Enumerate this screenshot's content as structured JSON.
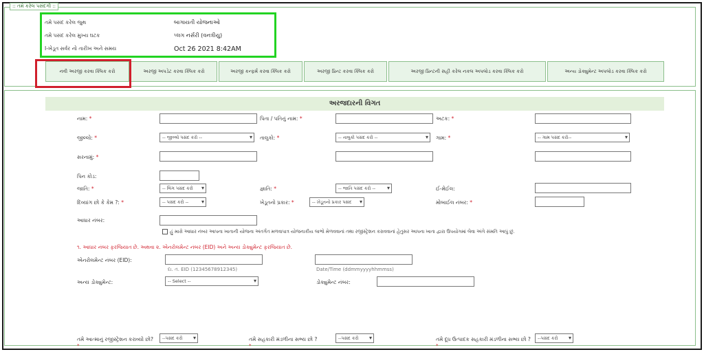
{
  "legend": ":: તમે કરેલ પસંદગી ::",
  "info": [
    {
      "label": "તમે પસંદ કરેલ જુથ",
      "value": "બાગાયતી યોજનાઓ"
    },
    {
      "label": "તમે પસંદ કરેલ મુખ્ય ઘટક",
      "value": "પ્લગ નર્સરી (વનત્રીયુ)"
    },
    {
      "label": "I-ખેડૂત સર્વર નો તારીખ અને સમય",
      "value": "Oct 26 2021 8:42AM"
    }
  ],
  "tabs": [
    "નવી અરજી કરવા ક્લિક કરો",
    "અરજી અપડેટ કરવા ક્લિક કરો",
    "અરજી કન્ફર્મ કરવા ક્લિક કરો",
    "અરજી પ્રિન્ટ કરવા ક્લિક કરો",
    "અરજી પ્રિન્ટની સહી કરેલ નકલ અપલોડ કરવા ક્લિક કરો",
    "અન્ય ડોક્યુમેન્ટ અપલોડ કરવા ક્લિક કરો"
  ],
  "section_title": "અરજદારની વિગત",
  "labels": {
    "name": "નામ:",
    "father": "પિતા / પતિનું નામ:",
    "surname": "અટક:",
    "district": "જીલ્લો:",
    "taluka": "તાલુકો:",
    "village": "ગામ:",
    "address": "સરનામું:",
    "pincode": "પિન કોડ:",
    "gender": "જાતિ:",
    "category": "જ્ઞાતિ:",
    "email": "ઈ-મેઈલ:",
    "disabled": "દિવ્યાંગ છો કે કેમ ?:",
    "farmer_type": "ખેડૂતનો પ્રકાર:",
    "mobile": "મોબાઈલ નંબર:",
    "aadhar": "આધાર નંબર:",
    "eid": "એનરોલમેન્ટ નંબર (EID):",
    "other_doc": "અન્ય ડોક્યુમેન્ટ:",
    "doc_no": "ડોક્યુમેન્ટ નંબર:",
    "q_reg": "તમે આત્માનું રજીસ્ટ્રેશન કરાવ્યો છો?",
    "q_coop": "તમે સહકારી મંડળીના સભ્ય છો ?",
    "q_milk": "તમે દૂધ ઉત્પાદક સહકારી મંડળીના સભ્ય છો ?"
  },
  "selects": {
    "district": "-- જીલ્લો પસંદ કરો --",
    "taluka": "-- તાલુકો પસંદ કરો --",
    "village": "-- ગામ પસંદ કરો--",
    "gender": "-- લિંગ પસંદ કરો",
    "category": "-- જાતિ પસંદ કરો --",
    "disabled": "-- પસંદ કરો --",
    "farmer_type": "-- ખેડૂતનો પ્રકાર પસંદ",
    "other_doc": "-- Select --",
    "q_reg": "--પસંદ કરો",
    "q_coop": "--પસંદ કરો",
    "q_milk": "--પસંદ કરો"
  },
  "consent": "હું મારો આધાર નંબર આપના ખાતાની યોજના અંતર્ગત મળવાપાત્ર યોજનાકીય લાભો મેળવવાનાં તથા રજીસ્ટ્રેશન કરાવવાનાં હેતુસર આપના ખાતા દ્વારા ઉપયોગમાં લેવા અંગે સંમતિ આપું છું.",
  "red_note": "૧. આધાર નંબર ફરજિયાત છે. અથવા ૨. એનરોલમેન્ટ નંબર (EID) અને અન્ય ડોક્યુમેન્ટ ફરજિયાત છે.",
  "hints": {
    "eid": "દા. ત. EID (12345678912345)",
    "datetime": "Date/Time (ddmmyyyyhhmmss)"
  },
  "colors": {
    "green_box": "#22d322",
    "red_box": "#d01f2c",
    "tab_bg": "#e8f4e8",
    "section_head_bg": "#e3f0db"
  }
}
